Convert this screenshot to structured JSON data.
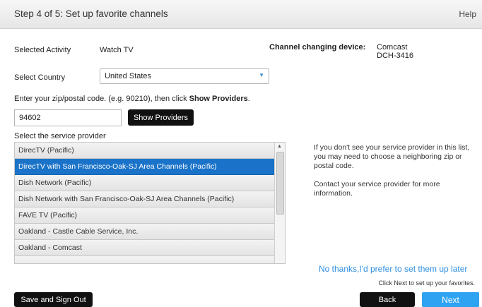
{
  "header": {
    "title": "Step 4 of 5: Set up favorite channels",
    "help": "Help"
  },
  "activity": {
    "label": "Selected Activity",
    "value": "Watch TV"
  },
  "device": {
    "label": "Channel changing device:",
    "brand": "Comcast",
    "model": "DCH-3416"
  },
  "country": {
    "label": "Select Country",
    "selected": "United States"
  },
  "zip": {
    "instruction_prefix": "Enter your zip/postal code. (e.g. 90210), then click ",
    "instruction_bold": "Show Providers",
    "instruction_suffix": ".",
    "value": "94602",
    "button": "Show Providers"
  },
  "providers": {
    "label": "Select the service provider",
    "items": [
      "DirecTV (Pacific)",
      "DirecTV with San Francisco-Oak-SJ Area Channels (Pacific)",
      "Dish Network (Pacific)",
      "Dish Network with San Francisco-Oak-SJ Area Channels (Pacific)",
      "FAVE TV (Pacific)",
      "Oakland - Castle Cable Service, Inc.",
      "Oakland - Comcast"
    ],
    "selected_index": 1
  },
  "help_text": {
    "p1": "If you don't see your service provider in this list, you may need to choose a neighboring zip or postal code.",
    "p2": "Contact your service provider for more information."
  },
  "footer": {
    "later_link": "No thanks,I'd prefer to set them up later",
    "note": "Click Next to set up your favorites.",
    "save_signout": "Save and Sign Out",
    "back": "Back",
    "next": "Next"
  },
  "colors": {
    "accent": "#2ea3f2",
    "selected_row": "#1a73c8",
    "dark_button": "#111111"
  }
}
